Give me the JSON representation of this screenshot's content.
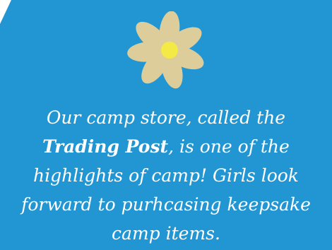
{
  "card": {
    "background_color": "#2196d3",
    "corner_fill_color": "#ffffff",
    "flower": {
      "icon": "daisy-icon",
      "petal_color": "#dccd9b",
      "center_color": "#f3ea45"
    },
    "caption": {
      "line1": "Our camp store, called the",
      "store_name": "Trading Post",
      "line2_rest": ", is one of the",
      "line3": "highlights of camp! Girls look",
      "line4": "forward to purhcasing keepsake",
      "line5": "camp items."
    }
  }
}
